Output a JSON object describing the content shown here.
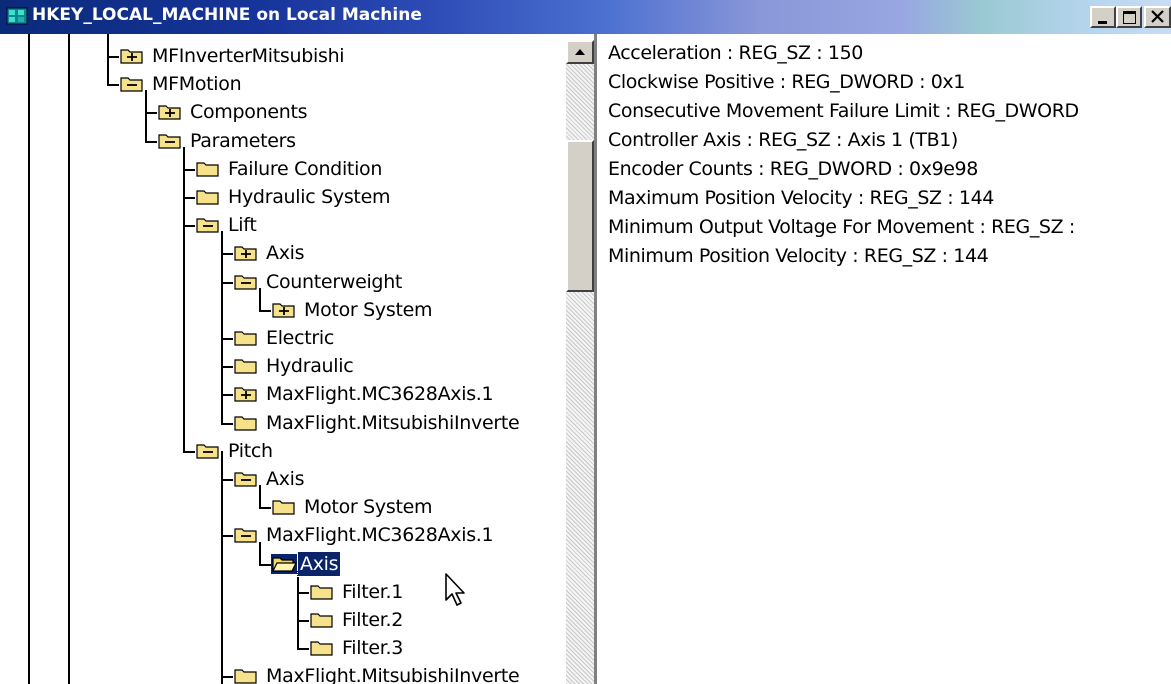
{
  "window": {
    "title": "HKEY_LOCAL_MACHINE on Local Machine",
    "title_icon": "registry-icon",
    "controls": [
      "minimize",
      "maximize",
      "close"
    ]
  },
  "tree": {
    "nodes": [
      {
        "label": "MFInverterMitsubishi",
        "icon": "folder-plus-icon",
        "expanded": false
      },
      {
        "label": "MFMotion",
        "icon": "folder-minus-icon",
        "expanded": true
      },
      {
        "label": "Components",
        "icon": "folder-plus-icon",
        "expanded": false
      },
      {
        "label": "Parameters",
        "icon": "folder-minus-icon",
        "expanded": true
      },
      {
        "label": "Failure Condition",
        "icon": "folder-icon"
      },
      {
        "label": "Hydraulic System",
        "icon": "folder-icon"
      },
      {
        "label": "Lift",
        "icon": "folder-minus-icon",
        "expanded": true
      },
      {
        "label": "Axis",
        "icon": "folder-plus-icon",
        "expanded": false
      },
      {
        "label": "Counterweight",
        "icon": "folder-minus-icon",
        "expanded": true
      },
      {
        "label": "Motor System",
        "icon": "folder-plus-icon",
        "expanded": false
      },
      {
        "label": "Electric",
        "icon": "folder-icon"
      },
      {
        "label": "Hydraulic",
        "icon": "folder-icon"
      },
      {
        "label": "MaxFlight.MC3628Axis.1",
        "icon": "folder-plus-icon",
        "expanded": false
      },
      {
        "label": "MaxFlight.MitsubishiInverte",
        "icon": "folder-icon"
      },
      {
        "label": "Pitch",
        "icon": "folder-minus-icon",
        "expanded": true
      },
      {
        "label": "Axis",
        "icon": "folder-minus-icon",
        "expanded": true
      },
      {
        "label": "Motor System",
        "icon": "folder-icon"
      },
      {
        "label": "MaxFlight.MC3628Axis.1",
        "icon": "folder-minus-icon",
        "expanded": true
      },
      {
        "label": "Axis",
        "icon": "folder-open-icon",
        "selected": true
      },
      {
        "label": "Filter.1",
        "icon": "folder-icon"
      },
      {
        "label": "Filter.2",
        "icon": "folder-icon"
      },
      {
        "label": "Filter.3",
        "icon": "folder-icon"
      },
      {
        "label": "MaxFlight.MitsubishiInverte",
        "icon": "folder-icon"
      }
    ]
  },
  "values": [
    "Acceleration : REG_SZ : 150",
    "Clockwise Positive : REG_DWORD : 0x1",
    "Consecutive Movement Failure Limit : REG_DWORD",
    "Controller Axis : REG_SZ : Axis 1 (TB1)",
    "Encoder Counts : REG_DWORD : 0x9e98",
    "Maximum Position Velocity : REG_SZ : 144",
    "Minimum Output Voltage For Movement : REG_SZ :",
    "Minimum Position Velocity : REG_SZ : 144"
  ],
  "colors": {
    "selection": "#0a246a",
    "folder": "#f5e28a",
    "title_text": "#ffffff"
  }
}
